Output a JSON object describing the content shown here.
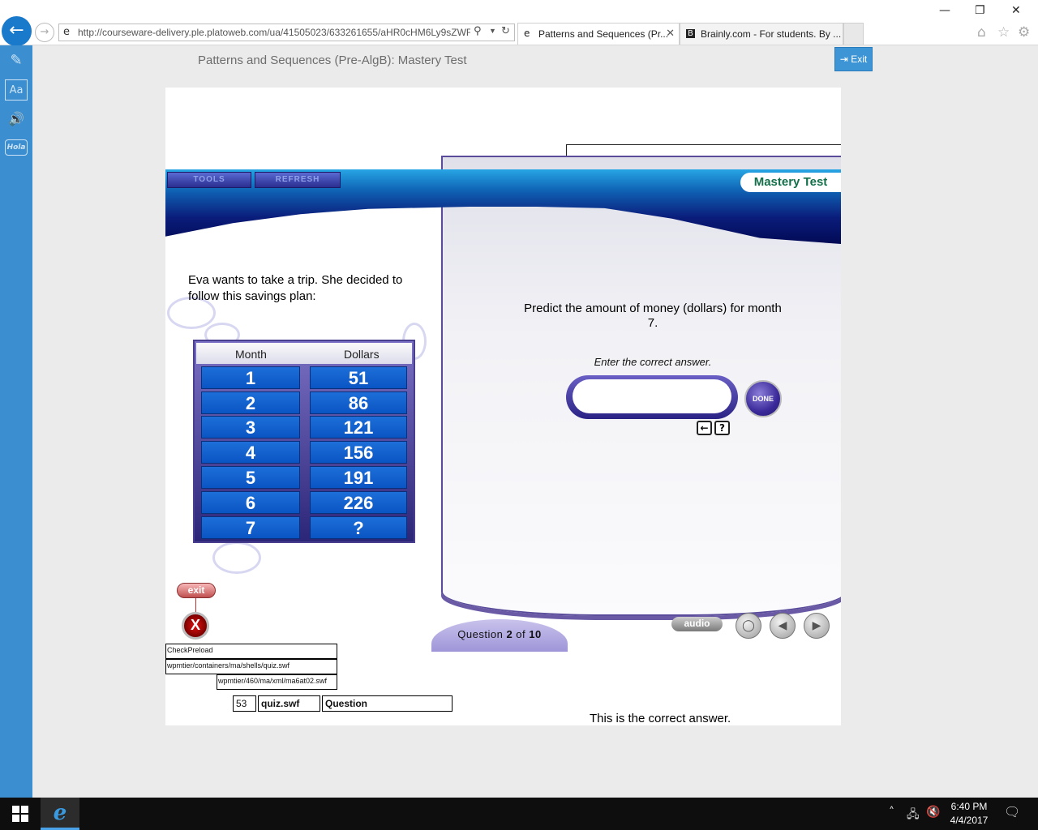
{
  "browser": {
    "url": "http://courseware-delivery.ple.platoweb.com/ua/41505023/633261655/aHR0cHM6Ly9sZWFj",
    "tabs": [
      {
        "label": "Patterns and Sequences (Pr...",
        "close": "✕"
      },
      {
        "label": "Brainly.com - For students. By ...",
        "icon": "B"
      }
    ],
    "window_controls": {
      "minimize": "—",
      "restore": "❐",
      "close": "✕"
    }
  },
  "header": {
    "title": "Patterns and Sequences (Pre-AlgB): Mastery Test",
    "exit_label": "Exit"
  },
  "sidebar": {
    "items": [
      {
        "icon": "notes-icon",
        "glyph": "✎"
      },
      {
        "icon": "dictionary-icon",
        "glyph": "Aa"
      },
      {
        "icon": "read-aloud-icon",
        "glyph": "🔊"
      },
      {
        "icon": "hola-translate-icon",
        "glyph": "Hola"
      }
    ]
  },
  "activity": {
    "tools_label": "TOOLS",
    "refresh_label": "REFRESH",
    "badge": "Mastery Test",
    "problem_text": "Eva wants to take a trip.  She decided to follow this savings plan:",
    "table": {
      "headers": [
        "Month",
        "Dollars"
      ],
      "rows": [
        [
          "1",
          "51"
        ],
        [
          "2",
          "86"
        ],
        [
          "3",
          "121"
        ],
        [
          "4",
          "156"
        ],
        [
          "5",
          "191"
        ],
        [
          "6",
          "226"
        ],
        [
          "7",
          "?"
        ]
      ]
    },
    "question": "Predict the amount of money (dollars) for month 7.",
    "instruction": "Enter the correct answer.",
    "answer_value": "",
    "done_label": "DONE",
    "backspace_label": "←",
    "help_label": "?",
    "exit_label": "exit",
    "exit_x": "X",
    "question_word": "Question",
    "question_number": "2",
    "of_word": "of",
    "question_total": "10",
    "audio_label": "audio",
    "feedback": "This is the correct answer."
  },
  "debug": {
    "line1": "CheckPreload",
    "line2": "wpmtier/containers/ma/shells/quiz.swf",
    "line3": "wpmtier/460/ma/xml/ma6at02.swf",
    "num": "53",
    "file": "quiz.swf",
    "type": "Question"
  },
  "taskbar": {
    "time": "6:40 PM",
    "date": "4/4/2017"
  },
  "colors": {
    "sidebar": "#3b8fd0",
    "exit_button": "#3d95d6",
    "table_cell": "#1d6fd8",
    "mastery_text": "#14704a"
  }
}
